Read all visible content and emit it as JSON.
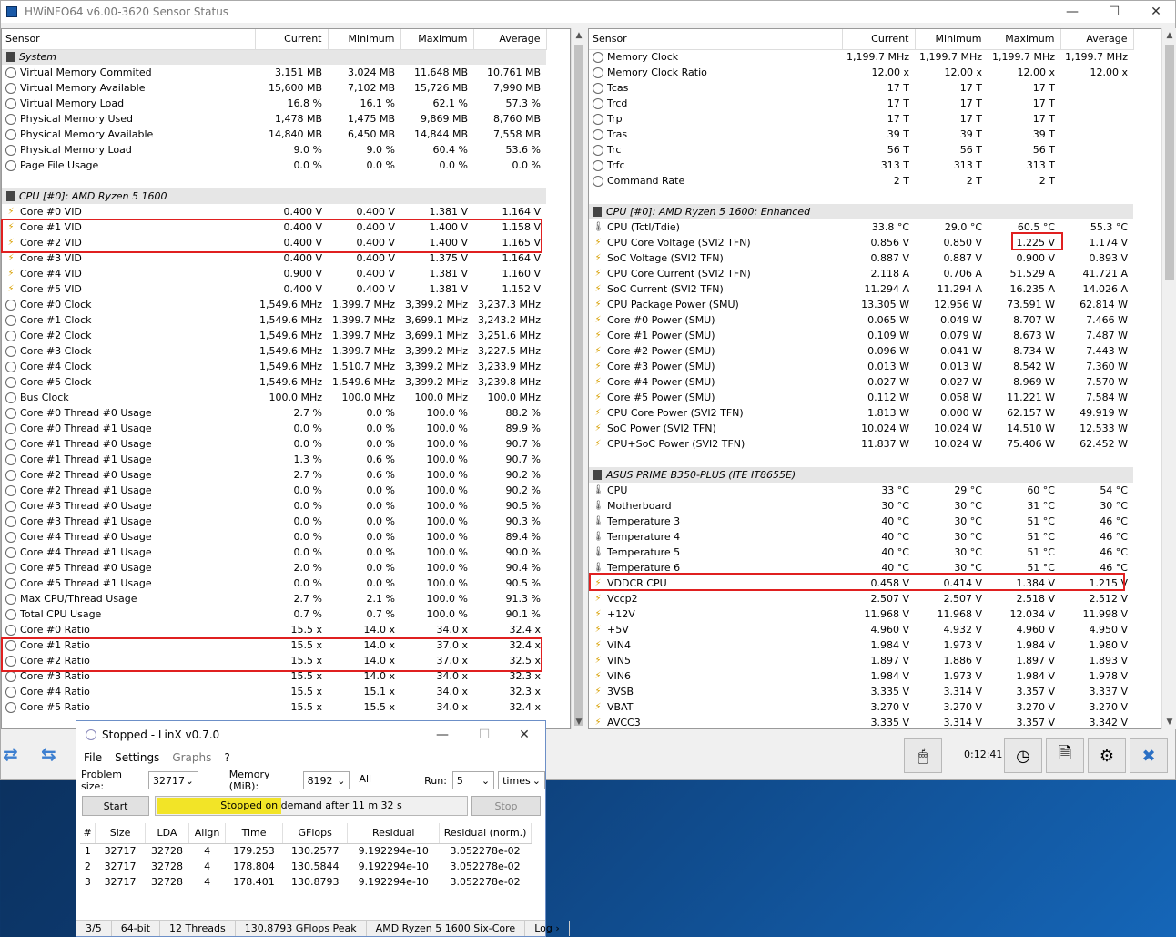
{
  "hw": {
    "title": "HWiNFO64 v6.00-3620 Sensor Status",
    "elapsed": "0:12:41"
  },
  "left_headers": [
    "Sensor",
    "Current",
    "Minimum",
    "Maximum",
    "Average"
  ],
  "right_headers": [
    "Sensor",
    "Current",
    "Minimum",
    "Maximum",
    "Average"
  ],
  "left_rows": [
    {
      "t": "g",
      "name": "System"
    },
    {
      "i": "clock",
      "name": "Virtual Memory Commited",
      "c": "3,151 MB",
      "mn": "3,024 MB",
      "mx": "11,648 MB",
      "av": "10,761 MB"
    },
    {
      "i": "clock",
      "name": "Virtual Memory Available",
      "c": "15,600 MB",
      "mn": "7,102 MB",
      "mx": "15,726 MB",
      "av": "7,990 MB"
    },
    {
      "i": "clock",
      "name": "Virtual Memory Load",
      "c": "16.8 %",
      "mn": "16.1 %",
      "mx": "62.1 %",
      "av": "57.3 %"
    },
    {
      "i": "clock",
      "name": "Physical Memory Used",
      "c": "1,478 MB",
      "mn": "1,475 MB",
      "mx": "9,869 MB",
      "av": "8,760 MB"
    },
    {
      "i": "clock",
      "name": "Physical Memory Available",
      "c": "14,840 MB",
      "mn": "6,450 MB",
      "mx": "14,844 MB",
      "av": "7,558 MB"
    },
    {
      "i": "clock",
      "name": "Physical Memory Load",
      "c": "9.0 %",
      "mn": "9.0 %",
      "mx": "60.4 %",
      "av": "53.6 %"
    },
    {
      "i": "clock",
      "name": "Page File Usage",
      "c": "0.0 %",
      "mn": "0.0 %",
      "mx": "0.0 %",
      "av": "0.0 %"
    },
    {
      "t": "e"
    },
    {
      "t": "g",
      "name": "CPU [#0]: AMD Ryzen 5 1600"
    },
    {
      "i": "volt",
      "name": "Core #0 VID",
      "c": "0.400 V",
      "mn": "0.400 V",
      "mx": "1.381 V",
      "av": "1.164 V"
    },
    {
      "i": "volt",
      "name": "Core #1 VID",
      "c": "0.400 V",
      "mn": "0.400 V",
      "mx": "1.400 V",
      "av": "1.158 V"
    },
    {
      "i": "volt",
      "name": "Core #2 VID",
      "c": "0.400 V",
      "mn": "0.400 V",
      "mx": "1.400 V",
      "av": "1.165 V"
    },
    {
      "i": "volt",
      "name": "Core #3 VID",
      "c": "0.400 V",
      "mn": "0.400 V",
      "mx": "1.375 V",
      "av": "1.164 V"
    },
    {
      "i": "volt",
      "name": "Core #4 VID",
      "c": "0.900 V",
      "mn": "0.400 V",
      "mx": "1.381 V",
      "av": "1.160 V"
    },
    {
      "i": "volt",
      "name": "Core #5 VID",
      "c": "0.400 V",
      "mn": "0.400 V",
      "mx": "1.381 V",
      "av": "1.152 V"
    },
    {
      "i": "clock",
      "name": "Core #0 Clock",
      "c": "1,549.6 MHz",
      "mn": "1,399.7 MHz",
      "mx": "3,399.2 MHz",
      "av": "3,237.3 MHz"
    },
    {
      "i": "clock",
      "name": "Core #1 Clock",
      "c": "1,549.6 MHz",
      "mn": "1,399.7 MHz",
      "mx": "3,699.1 MHz",
      "av": "3,243.2 MHz"
    },
    {
      "i": "clock",
      "name": "Core #2 Clock",
      "c": "1,549.6 MHz",
      "mn": "1,399.7 MHz",
      "mx": "3,699.1 MHz",
      "av": "3,251.6 MHz"
    },
    {
      "i": "clock",
      "name": "Core #3 Clock",
      "c": "1,549.6 MHz",
      "mn": "1,399.7 MHz",
      "mx": "3,399.2 MHz",
      "av": "3,227.5 MHz"
    },
    {
      "i": "clock",
      "name": "Core #4 Clock",
      "c": "1,549.6 MHz",
      "mn": "1,510.7 MHz",
      "mx": "3,399.2 MHz",
      "av": "3,233.9 MHz"
    },
    {
      "i": "clock",
      "name": "Core #5 Clock",
      "c": "1,549.6 MHz",
      "mn": "1,549.6 MHz",
      "mx": "3,399.2 MHz",
      "av": "3,239.8 MHz"
    },
    {
      "i": "clock",
      "name": "Bus Clock",
      "c": "100.0 MHz",
      "mn": "100.0 MHz",
      "mx": "100.0 MHz",
      "av": "100.0 MHz"
    },
    {
      "i": "clock",
      "name": "Core #0 Thread #0 Usage",
      "c": "2.7 %",
      "mn": "0.0 %",
      "mx": "100.0 %",
      "av": "88.2 %"
    },
    {
      "i": "clock",
      "name": "Core #0 Thread #1 Usage",
      "c": "0.0 %",
      "mn": "0.0 %",
      "mx": "100.0 %",
      "av": "89.9 %"
    },
    {
      "i": "clock",
      "name": "Core #1 Thread #0 Usage",
      "c": "0.0 %",
      "mn": "0.0 %",
      "mx": "100.0 %",
      "av": "90.7 %"
    },
    {
      "i": "clock",
      "name": "Core #1 Thread #1 Usage",
      "c": "1.3 %",
      "mn": "0.6 %",
      "mx": "100.0 %",
      "av": "90.7 %"
    },
    {
      "i": "clock",
      "name": "Core #2 Thread #0 Usage",
      "c": "2.7 %",
      "mn": "0.6 %",
      "mx": "100.0 %",
      "av": "90.2 %"
    },
    {
      "i": "clock",
      "name": "Core #2 Thread #1 Usage",
      "c": "0.0 %",
      "mn": "0.0 %",
      "mx": "100.0 %",
      "av": "90.2 %"
    },
    {
      "i": "clock",
      "name": "Core #3 Thread #0 Usage",
      "c": "0.0 %",
      "mn": "0.0 %",
      "mx": "100.0 %",
      "av": "90.5 %"
    },
    {
      "i": "clock",
      "name": "Core #3 Thread #1 Usage",
      "c": "0.0 %",
      "mn": "0.0 %",
      "mx": "100.0 %",
      "av": "90.3 %"
    },
    {
      "i": "clock",
      "name": "Core #4 Thread #0 Usage",
      "c": "0.0 %",
      "mn": "0.0 %",
      "mx": "100.0 %",
      "av": "89.4 %"
    },
    {
      "i": "clock",
      "name": "Core #4 Thread #1 Usage",
      "c": "0.0 %",
      "mn": "0.0 %",
      "mx": "100.0 %",
      "av": "90.0 %"
    },
    {
      "i": "clock",
      "name": "Core #5 Thread #0 Usage",
      "c": "2.0 %",
      "mn": "0.0 %",
      "mx": "100.0 %",
      "av": "90.4 %"
    },
    {
      "i": "clock",
      "name": "Core #5 Thread #1 Usage",
      "c": "0.0 %",
      "mn": "0.0 %",
      "mx": "100.0 %",
      "av": "90.5 %"
    },
    {
      "i": "clock",
      "name": "Max CPU/Thread Usage",
      "c": "2.7 %",
      "mn": "2.1 %",
      "mx": "100.0 %",
      "av": "91.3 %"
    },
    {
      "i": "clock",
      "name": "Total CPU Usage",
      "c": "0.7 %",
      "mn": "0.7 %",
      "mx": "100.0 %",
      "av": "90.1 %"
    },
    {
      "i": "clock",
      "name": "Core #0 Ratio",
      "c": "15.5 x",
      "mn": "14.0 x",
      "mx": "34.0 x",
      "av": "32.4 x"
    },
    {
      "i": "clock",
      "name": "Core #1 Ratio",
      "c": "15.5 x",
      "mn": "14.0 x",
      "mx": "37.0 x",
      "av": "32.4 x"
    },
    {
      "i": "clock",
      "name": "Core #2 Ratio",
      "c": "15.5 x",
      "mn": "14.0 x",
      "mx": "37.0 x",
      "av": "32.5 x"
    },
    {
      "i": "clock",
      "name": "Core #3 Ratio",
      "c": "15.5 x",
      "mn": "14.0 x",
      "mx": "34.0 x",
      "av": "32.3 x"
    },
    {
      "i": "clock",
      "name": "Core #4 Ratio",
      "c": "15.5 x",
      "mn": "15.1 x",
      "mx": "34.0 x",
      "av": "32.3 x"
    },
    {
      "i": "clock",
      "name": "Core #5 Ratio",
      "c": "15.5 x",
      "mn": "15.5 x",
      "mx": "34.0 x",
      "av": "32.4 x"
    }
  ],
  "right_rows": [
    {
      "i": "clock",
      "name": "Memory Clock",
      "c": "1,199.7 MHz",
      "mn": "1,199.7 MHz",
      "mx": "1,199.7 MHz",
      "av": "1,199.7 MHz"
    },
    {
      "i": "clock",
      "name": "Memory Clock Ratio",
      "c": "12.00 x",
      "mn": "12.00 x",
      "mx": "12.00 x",
      "av": "12.00 x"
    },
    {
      "i": "clock",
      "name": "Tcas",
      "c": "17 T",
      "mn": "17 T",
      "mx": "17 T",
      "av": ""
    },
    {
      "i": "clock",
      "name": "Trcd",
      "c": "17 T",
      "mn": "17 T",
      "mx": "17 T",
      "av": ""
    },
    {
      "i": "clock",
      "name": "Trp",
      "c": "17 T",
      "mn": "17 T",
      "mx": "17 T",
      "av": ""
    },
    {
      "i": "clock",
      "name": "Tras",
      "c": "39 T",
      "mn": "39 T",
      "mx": "39 T",
      "av": ""
    },
    {
      "i": "clock",
      "name": "Trc",
      "c": "56 T",
      "mn": "56 T",
      "mx": "56 T",
      "av": ""
    },
    {
      "i": "clock",
      "name": "Trfc",
      "c": "313 T",
      "mn": "313 T",
      "mx": "313 T",
      "av": ""
    },
    {
      "i": "clock",
      "name": "Command Rate",
      "c": "2 T",
      "mn": "2 T",
      "mx": "2 T",
      "av": ""
    },
    {
      "t": "e"
    },
    {
      "t": "g",
      "name": "CPU [#0]: AMD Ryzen 5 1600: Enhanced"
    },
    {
      "i": "therm",
      "name": "CPU (Tctl/Tdie)",
      "c": "33.8 °C",
      "mn": "29.0 °C",
      "mx": "60.5 °C",
      "av": "55.3 °C"
    },
    {
      "i": "volt",
      "name": "CPU Core Voltage (SVI2 TFN)",
      "c": "0.856 V",
      "mn": "0.850 V",
      "mx": "1.225 V",
      "av": "1.174 V"
    },
    {
      "i": "volt",
      "name": "SoC Voltage (SVI2 TFN)",
      "c": "0.887 V",
      "mn": "0.887 V",
      "mx": "0.900 V",
      "av": "0.893 V"
    },
    {
      "i": "volt",
      "name": "CPU Core Current (SVI2 TFN)",
      "c": "2.118 A",
      "mn": "0.706 A",
      "mx": "51.529 A",
      "av": "41.721 A"
    },
    {
      "i": "volt",
      "name": "SoC Current (SVI2 TFN)",
      "c": "11.294 A",
      "mn": "11.294 A",
      "mx": "16.235 A",
      "av": "14.026 A"
    },
    {
      "i": "volt",
      "name": "CPU Package Power (SMU)",
      "c": "13.305 W",
      "mn": "12.956 W",
      "mx": "73.591 W",
      "av": "62.814 W"
    },
    {
      "i": "volt",
      "name": "Core #0 Power (SMU)",
      "c": "0.065 W",
      "mn": "0.049 W",
      "mx": "8.707 W",
      "av": "7.466 W"
    },
    {
      "i": "volt",
      "name": "Core #1 Power (SMU)",
      "c": "0.109 W",
      "mn": "0.079 W",
      "mx": "8.673 W",
      "av": "7.487 W"
    },
    {
      "i": "volt",
      "name": "Core #2 Power (SMU)",
      "c": "0.096 W",
      "mn": "0.041 W",
      "mx": "8.734 W",
      "av": "7.443 W"
    },
    {
      "i": "volt",
      "name": "Core #3 Power (SMU)",
      "c": "0.013 W",
      "mn": "0.013 W",
      "mx": "8.542 W",
      "av": "7.360 W"
    },
    {
      "i": "volt",
      "name": "Core #4 Power (SMU)",
      "c": "0.027 W",
      "mn": "0.027 W",
      "mx": "8.969 W",
      "av": "7.570 W"
    },
    {
      "i": "volt",
      "name": "Core #5 Power (SMU)",
      "c": "0.112 W",
      "mn": "0.058 W",
      "mx": "11.221 W",
      "av": "7.584 W"
    },
    {
      "i": "volt",
      "name": "CPU Core Power (SVI2 TFN)",
      "c": "1.813 W",
      "mn": "0.000 W",
      "mx": "62.157 W",
      "av": "49.919 W"
    },
    {
      "i": "volt",
      "name": "SoC Power (SVI2 TFN)",
      "c": "10.024 W",
      "mn": "10.024 W",
      "mx": "14.510 W",
      "av": "12.533 W"
    },
    {
      "i": "volt",
      "name": "CPU+SoC Power (SVI2 TFN)",
      "c": "11.837 W",
      "mn": "10.024 W",
      "mx": "75.406 W",
      "av": "62.452 W"
    },
    {
      "t": "e"
    },
    {
      "t": "g",
      "name": "ASUS PRIME B350-PLUS (ITE IT8655E)"
    },
    {
      "i": "therm",
      "name": "CPU",
      "c": "33 °C",
      "mn": "29 °C",
      "mx": "60 °C",
      "av": "54 °C"
    },
    {
      "i": "therm",
      "name": "Motherboard",
      "c": "30 °C",
      "mn": "30 °C",
      "mx": "31 °C",
      "av": "30 °C"
    },
    {
      "i": "therm",
      "name": "Temperature 3",
      "c": "40 °C",
      "mn": "30 °C",
      "mx": "51 °C",
      "av": "46 °C"
    },
    {
      "i": "therm",
      "name": "Temperature 4",
      "c": "40 °C",
      "mn": "30 °C",
      "mx": "51 °C",
      "av": "46 °C"
    },
    {
      "i": "therm",
      "name": "Temperature 5",
      "c": "40 °C",
      "mn": "30 °C",
      "mx": "51 °C",
      "av": "46 °C"
    },
    {
      "i": "therm",
      "name": "Temperature 6",
      "c": "40 °C",
      "mn": "30 °C",
      "mx": "51 °C",
      "av": "46 °C"
    },
    {
      "i": "volt",
      "name": "VDDCR CPU",
      "c": "0.458 V",
      "mn": "0.414 V",
      "mx": "1.384 V",
      "av": "1.215 V"
    },
    {
      "i": "volt",
      "name": "Vccp2",
      "c": "2.507 V",
      "mn": "2.507 V",
      "mx": "2.518 V",
      "av": "2.512 V"
    },
    {
      "i": "volt",
      "name": "+12V",
      "c": "11.968 V",
      "mn": "11.968 V",
      "mx": "12.034 V",
      "av": "11.998 V"
    },
    {
      "i": "volt",
      "name": "+5V",
      "c": "4.960 V",
      "mn": "4.932 V",
      "mx": "4.960 V",
      "av": "4.950 V"
    },
    {
      "i": "volt",
      "name": "VIN4",
      "c": "1.984 V",
      "mn": "1.973 V",
      "mx": "1.984 V",
      "av": "1.980 V"
    },
    {
      "i": "volt",
      "name": "VIN5",
      "c": "1.897 V",
      "mn": "1.886 V",
      "mx": "1.897 V",
      "av": "1.893 V"
    },
    {
      "i": "volt",
      "name": "VIN6",
      "c": "1.984 V",
      "mn": "1.973 V",
      "mx": "1.984 V",
      "av": "1.978 V"
    },
    {
      "i": "volt",
      "name": "3VSB",
      "c": "3.335 V",
      "mn": "3.314 V",
      "mx": "3.357 V",
      "av": "3.337 V"
    },
    {
      "i": "volt",
      "name": "VBAT",
      "c": "3.270 V",
      "mn": "3.270 V",
      "mx": "3.270 V",
      "av": "3.270 V"
    },
    {
      "i": "volt",
      "name": "AVCC3",
      "c": "3.335 V",
      "mn": "3.314 V",
      "mx": "3.357 V",
      "av": "3.342 V"
    }
  ],
  "linx": {
    "title": "Stopped - LinX v0.7.0",
    "menu": [
      "File",
      "Settings",
      "Graphs",
      "?"
    ],
    "problem_label": "Problem size:",
    "problem_value": "32717",
    "memory_label": "Memory (MiB):",
    "memory_value": "8192",
    "all_label": "All",
    "run_label": "Run:",
    "run_value": "5",
    "run_unit": "times",
    "start_label": "Start",
    "stop_label": "Stop",
    "progress_text": "Stopped on demand after 11 m 32 s",
    "progress_fraction": 0.4,
    "headers": [
      "#",
      "Size",
      "LDA",
      "Align",
      "Time",
      "GFlops",
      "Residual",
      "Residual (norm.)"
    ],
    "rows": [
      [
        "1",
        "32717",
        "32728",
        "4",
        "179.253",
        "130.2577",
        "9.192294e-10",
        "3.052278e-02"
      ],
      [
        "2",
        "32717",
        "32728",
        "4",
        "178.804",
        "130.5844",
        "9.192294e-10",
        "3.052278e-02"
      ],
      [
        "3",
        "32717",
        "32728",
        "4",
        "178.401",
        "130.8793",
        "9.192294e-10",
        "3.052278e-02"
      ]
    ],
    "status": [
      "3/5",
      "64-bit",
      "12 Threads",
      "130.8793 GFlops Peak",
      "AMD Ryzen 5 1600 Six-Core",
      "Log ›"
    ]
  }
}
